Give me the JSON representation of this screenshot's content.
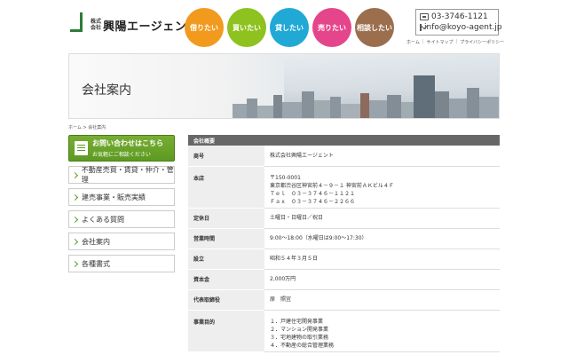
{
  "header": {
    "logo_prefix": [
      "株式",
      "会社"
    ],
    "logo_name": "興陽エージェント",
    "nav": [
      {
        "label": "借りたい",
        "color": "#f29a1e"
      },
      {
        "label": "買いたい",
        "color": "#8dc21f"
      },
      {
        "label": "貸したい",
        "color": "#21a9d6"
      },
      {
        "label": "売りたい",
        "color": "#e5458a"
      },
      {
        "label": "相談したい",
        "color": "#9b6e4e"
      }
    ],
    "phone": "03-3746-1121",
    "email": "info@koyo-agent.jp",
    "util_links": [
      "ホーム",
      "サイトマップ",
      "プライバシーポリシー"
    ]
  },
  "banner": {
    "title": "会社案内"
  },
  "breadcrumb": "ホーム > 会社案内",
  "sidebar": {
    "inquiry_main": "お問い合わせはこちら",
    "inquiry_sub": "お気軽にご相談ください",
    "items": [
      "不動産売買・賃貸・仲介・管理",
      "建売事業・販売実績",
      "よくある質問",
      "会社案内",
      "各種書式"
    ]
  },
  "company": {
    "section_title": "会社概要",
    "rows": [
      {
        "label": "商号",
        "lines": [
          "株式会社興陽エージェント"
        ]
      },
      {
        "label": "本店",
        "lines": [
          "〒150-0001",
          "東京都渋谷区神宮前４－９－１ 神宮前ＡＫビル４Ｆ",
          "Ｔｅｌ　０３－３７４６－１１２１",
          "Ｆａｘ　０３－３７４６－２２６６"
        ]
      },
      {
        "label": "定休日",
        "lines": [
          "土曜日・日曜日／祝日"
        ]
      },
      {
        "label": "営業時間",
        "lines": [
          "9:00～18:00（水曜日は9:00～17:30）"
        ]
      },
      {
        "label": "設立",
        "lines": [
          "昭和５４年３月５日"
        ]
      },
      {
        "label": "資本金",
        "lines": [
          "2,000万円"
        ]
      },
      {
        "label": "代表取締役",
        "lines": [
          "原　照宜"
        ]
      },
      {
        "label": "事業目的",
        "lines": [
          "１．戸建住宅開発事業",
          "２．マンション開発事業",
          "３．宅地建物の取引業務",
          "４．不動産の総合管理業務"
        ]
      }
    ]
  }
}
